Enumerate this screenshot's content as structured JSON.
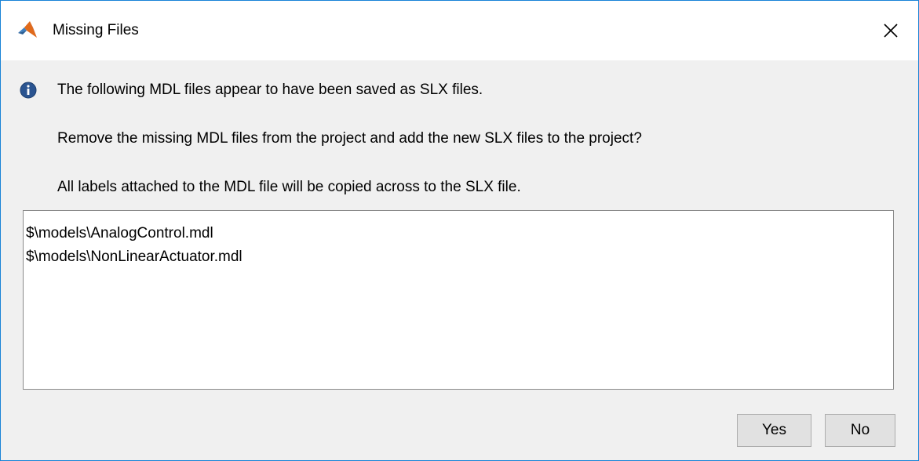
{
  "window": {
    "title": "Missing Files",
    "app_icon": "matlab-icon",
    "close_icon": "close-icon"
  },
  "message": {
    "icon": "info-icon",
    "line1": "The following MDL files appear to have been saved as SLX files.",
    "line2": "Remove the missing MDL files from the project and add the new SLX files to the project?",
    "line3": "All labels attached to the MDL file will be copied across to the SLX file."
  },
  "files": [
    "$\\models\\AnalogControl.mdl",
    "$\\models\\NonLinearActuator.mdl"
  ],
  "buttons": {
    "yes": "Yes",
    "no": "No"
  },
  "colors": {
    "window_border": "#1883d7",
    "dialog_background": "#f0f0f0",
    "info_icon": "#2a5490"
  }
}
